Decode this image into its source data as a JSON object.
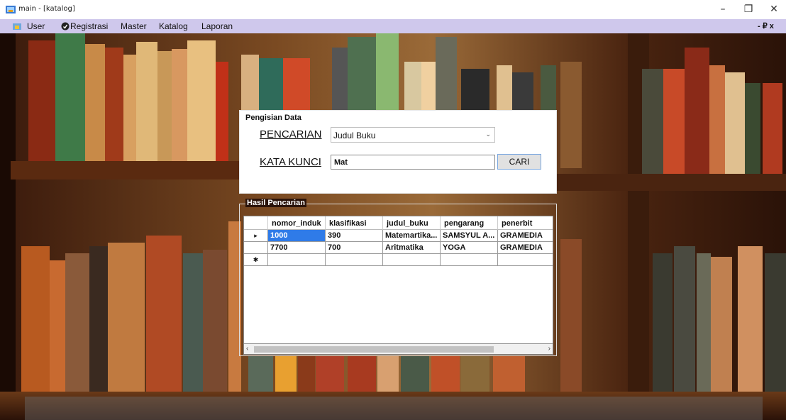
{
  "window": {
    "title": "main - [katalog]",
    "minimize": "–",
    "restore": "❐",
    "close": "✕"
  },
  "menu": {
    "items": [
      "User",
      "Registrasi",
      "Master",
      "Katalog",
      "Laporan"
    ],
    "mdi_controls": "- ₽ x"
  },
  "search_panel": {
    "legend": "Pengisian Data",
    "search_label": "PENCARIAN",
    "search_by_value": "Judul Buku",
    "keyword_label": "KATA KUNCI",
    "keyword_value": "Mat",
    "search_button": "CARI"
  },
  "results": {
    "legend": "Hasil Pencarian",
    "columns": [
      "nomor_induk",
      "klasifikasi",
      "judul_buku",
      "pengarang",
      "penerbit"
    ],
    "rows": [
      [
        "1000",
        "390",
        "Matemartika...",
        "SAMSYUL A...",
        "GRAMEDIA"
      ],
      [
        "7700",
        "700",
        "Aritmatika",
        "YOGA",
        "GRAMEDIA"
      ]
    ],
    "selected_row_marker": "▸",
    "new_row_marker": "✱"
  },
  "colors": {
    "menubar": "#cfc8ec",
    "selection": "#2f7be8",
    "background_wood": "#2a130a"
  }
}
